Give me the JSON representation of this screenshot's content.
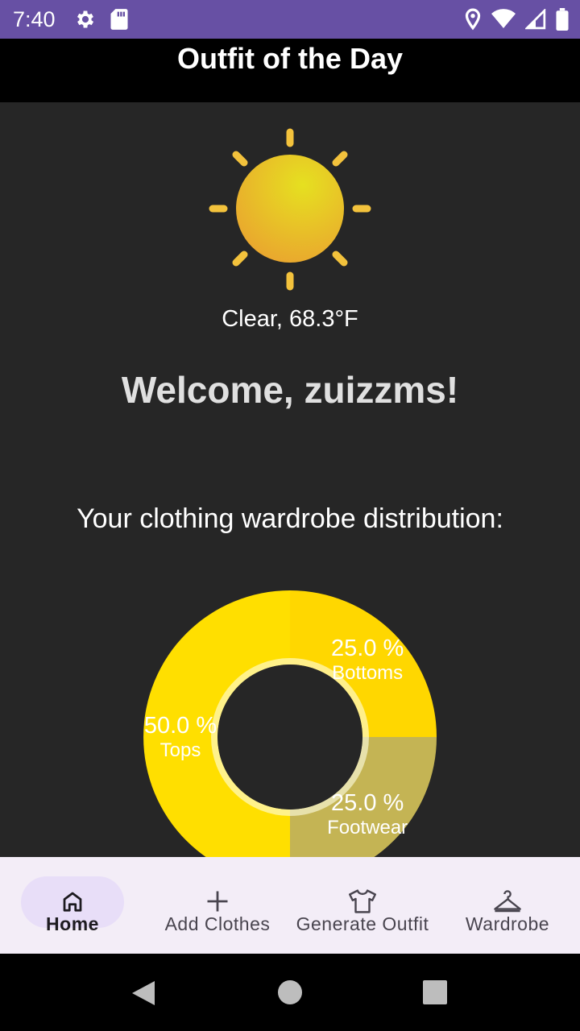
{
  "status_bar": {
    "time": "7:40",
    "icons": [
      "settings-icon",
      "sd-card-icon",
      "location-icon",
      "wifi-icon",
      "cellular-signal-icon",
      "battery-icon"
    ]
  },
  "app_bar": {
    "title": "Outfit of the Day"
  },
  "weather": {
    "icon": "sun-icon",
    "text": "Clear, 68.3°F"
  },
  "welcome": {
    "text": "Welcome, zuizzms!"
  },
  "distribution": {
    "title": "Your clothing wardrobe distribution:"
  },
  "chart_data": {
    "type": "pie",
    "categories": [
      "Tops",
      "Bottoms",
      "Footwear"
    ],
    "values": [
      50.0,
      25.0,
      25.0
    ],
    "value_labels": [
      "50.0 %",
      "25.0 %",
      "25.0 %"
    ],
    "colors": [
      "#ffdf00",
      "#ffd700",
      "#c4b454"
    ]
  },
  "bottom_nav": {
    "items": [
      {
        "label": "Home",
        "icon": "home-icon",
        "active": true
      },
      {
        "label": "Add Clothes",
        "icon": "plus-icon",
        "active": false
      },
      {
        "label": "Generate Outfit",
        "icon": "shirt-icon",
        "active": false
      },
      {
        "label": "Wardrobe",
        "icon": "hanger-icon",
        "active": false
      }
    ]
  },
  "system_nav": {
    "icons": [
      "back-icon",
      "home-circle-icon",
      "recents-icon"
    ]
  }
}
